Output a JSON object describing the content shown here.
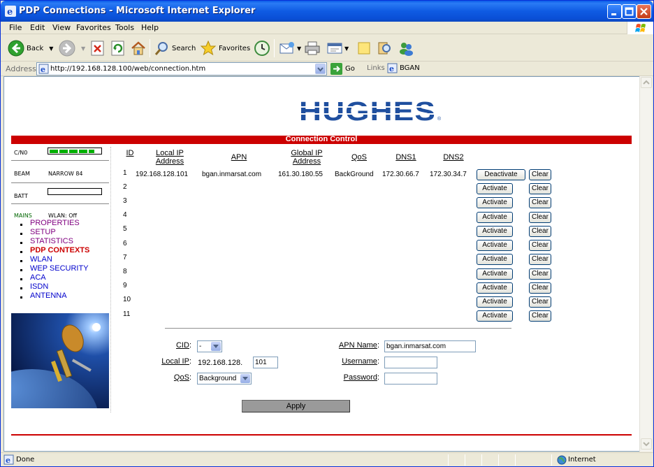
{
  "window": {
    "title": "PDP Connections - Microsoft Internet Explorer"
  },
  "menu": [
    "File",
    "Edit",
    "View",
    "Favorites",
    "Tools",
    "Help"
  ],
  "toolbar": {
    "back": "Back",
    "search": "Search",
    "favorites": "Favorites"
  },
  "address": {
    "label": "Address",
    "url": "http://192.168.128.100/web/connection.htm",
    "go": "Go",
    "links": "Links",
    "bgan": "BGAN"
  },
  "logo": {
    "text": "HUGHES",
    "mark": "®"
  },
  "section_title": "Connection Control",
  "status_panel": {
    "cn0_label": "C/N0",
    "cn0_level_bars": 5,
    "beam_label": "BEAM",
    "beam_value": "NARROW 84",
    "batt_label": "BATT",
    "mains_label": "MAINS",
    "wlan_value": "WLAN: Off"
  },
  "nav": [
    {
      "label": "PROPERTIES",
      "style": "purple"
    },
    {
      "label": "SETUP",
      "style": "purple"
    },
    {
      "label": "STATISTICS",
      "style": "purple"
    },
    {
      "label": "PDP CONTEXTS",
      "style": "red"
    },
    {
      "label": "WLAN",
      "style": "blue"
    },
    {
      "label": "WEP SECURITY",
      "style": "blue"
    },
    {
      "label": "ACA",
      "style": "blue"
    },
    {
      "label": "ISDN",
      "style": "blue"
    },
    {
      "label": "ANTENNA",
      "style": "blue"
    }
  ],
  "table": {
    "headers": {
      "id": "ID",
      "local_ip_1": "Local IP",
      "local_ip_2": "Address",
      "apn": "APN",
      "global_ip_1": "Global IP",
      "global_ip_2": "Address",
      "qos": "QoS",
      "dns1": "DNS1",
      "dns2": "DNS2"
    },
    "row1": {
      "id": "1",
      "local_ip": "192.168.128.101",
      "apn": "bgan.inmarsat.com",
      "global_ip": "161.30.180.55",
      "qos": "BackGround",
      "dns1": "172.30.66.7",
      "dns2": "172.30.34.7"
    },
    "ids": [
      "1",
      "2",
      "3",
      "4",
      "5",
      "6",
      "7",
      "8",
      "9",
      "10",
      "11"
    ],
    "deactivate_label": "Deactivate",
    "activate_label": "Activate",
    "clear_label": "Clear"
  },
  "form": {
    "cid_label": "CID",
    "cid_value": "-",
    "local_ip_label": "Local IP",
    "local_ip_prefix": "192.168.128.",
    "local_ip_suffix": "101",
    "qos_label": "QoS",
    "qos_value": "Background",
    "apn_name_label": "APN Name",
    "apn_name_value": "bgan.inmarsat.com",
    "username_label": "Username",
    "username_value": "",
    "password_label": "Password",
    "password_value": "",
    "apply_label": "Apply"
  },
  "statusbar": {
    "left": "Done",
    "zone": "Internet"
  }
}
